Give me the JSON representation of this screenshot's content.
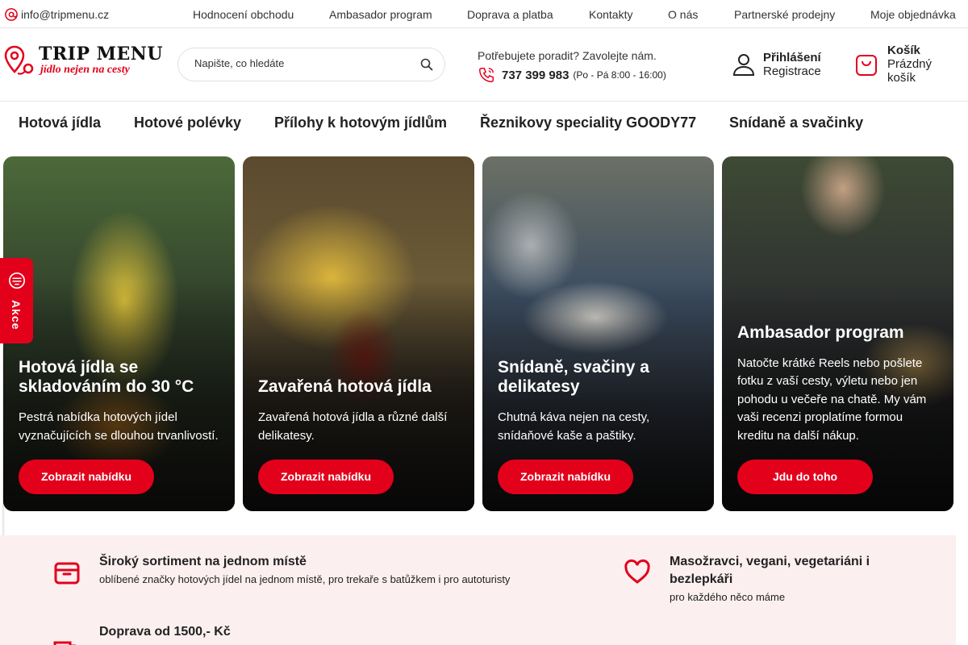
{
  "topbar": {
    "email": "info@tripmenu.cz",
    "links": [
      "Hodnocení obchodu",
      "Ambasador program",
      "Doprava a platba",
      "Kontakty",
      "O nás",
      "Partnerské prodejny",
      "Moje objednávka"
    ]
  },
  "logo": {
    "line1": "TRIP MENU",
    "line2": "jídlo nejen na cesty"
  },
  "search": {
    "placeholder": "Napište, co hledáte"
  },
  "help": {
    "question": "Potřebujete poradit? Zavolejte nám.",
    "phone": "737 399 983",
    "hours": "(Po - Pá 8:00 - 16:00)"
  },
  "account": {
    "login": "Přihlášení",
    "register": "Registrace"
  },
  "cart": {
    "title": "Košík",
    "status_line1": "Prázdný",
    "status_line2": "košík"
  },
  "categories": [
    "Hotová jídla",
    "Hotové polévky",
    "Přílohy k hotovým jídlům",
    "Řeznikovy speciality GOODY77",
    "Snídaně a svačinky"
  ],
  "cards": [
    {
      "title": "Hotová jídla se skladováním do 30 °C",
      "text": "Pestrá nabídka hotových jídel vyznačujících se dlouhou trvanlivostí.",
      "button": "Zobrazit nabídku"
    },
    {
      "title": "Zavařená hotová jídla",
      "text": "Zavařená hotová jídla a různé další delikatesy.",
      "button": "Zobrazit nabídku"
    },
    {
      "title": "Snídaně, svačiny a delikatesy",
      "text": "Chutná káva nejen na cesty, snídaňové kaše a paštiky.",
      "button": "Zobrazit nabídku"
    },
    {
      "title": "Ambasador program",
      "text": "Natočte krátké Reels nebo pošlete fotku z vaší cesty, výletu nebo jen pohodu u večeře na chatě. My vám vaši recenzi proplatíme formou kreditu na další nákup.",
      "button": "Jdu do toho"
    }
  ],
  "side_tab": {
    "label": "Akce"
  },
  "features": [
    {
      "title": "Široký sortiment na jednom místě",
      "desc": "oblíbené značky hotových jídel na jednom místě, pro trekaře s batůžkem i pro autoturisty",
      "icon": "box-icon"
    },
    {
      "title": "Masožravci, vegani, vegetariáni i bezlepkáři",
      "desc": "pro každého něco máme",
      "icon": "heart-icon"
    },
    {
      "title": "Doprava od 1500,- Kč",
      "desc": "",
      "icon": "truck-icon"
    }
  ],
  "colors": {
    "accent": "#e3001b",
    "feature_bg": "#fbeff0"
  }
}
